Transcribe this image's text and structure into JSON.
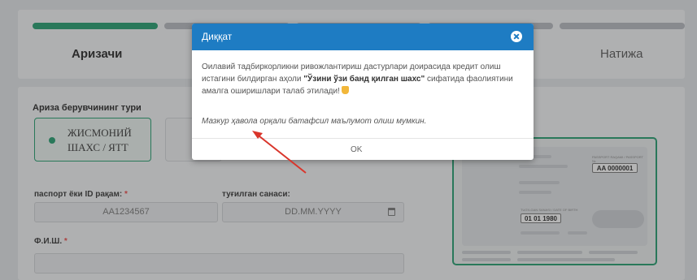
{
  "stepper": {
    "steps": [
      {
        "label": "Аризачи",
        "active": true
      },
      {
        "label": "",
        "active": false
      },
      {
        "label": "",
        "active": false
      },
      {
        "label": "",
        "active": false
      },
      {
        "label": "Натижа",
        "active": false
      }
    ]
  },
  "form": {
    "applicant_type_title": "Ариза берувчининг тури",
    "applicant_type_line1": "ЖИСМОНИЙ",
    "applicant_type_line2": "ШАХС / ЯТТ",
    "passport_label": "паспорт ёки ID рақам:",
    "passport_placeholder": "AA1234567",
    "birthdate_label": "туғилган санаси:",
    "birthdate_placeholder": "DD.MM.YYYY",
    "fio_label": "Ф.И.Ш.",
    "required_mark": "*"
  },
  "passport_image": {
    "header_text": "PASSPORT RAQAMI / PASSPORT №",
    "number": "AA 0000001",
    "birth_caption": "TUG'ILGAN SANASI / DATE OF BIRTH",
    "birth_date": "01 01 1980"
  },
  "modal": {
    "title": "Диққат",
    "body_pre": "Оилавий тадбиркорликни ривожлантириш дастурлари доирасида кредит олиш истагини билдирган аҳоли ",
    "body_bold": "\"Ўзини ўзи банд қилган шахс\"",
    "body_post": " сифатида фаолиятини амалга оширишлари талаб этилади!",
    "link_text": "Мазкур ҳавола орқали батафсил маълумот олиш мумкин.",
    "ok_label": "OK"
  },
  "colors": {
    "accent": "#1d9d6c",
    "modal_header": "#1e7cc3",
    "arrow": "#d9352b"
  }
}
